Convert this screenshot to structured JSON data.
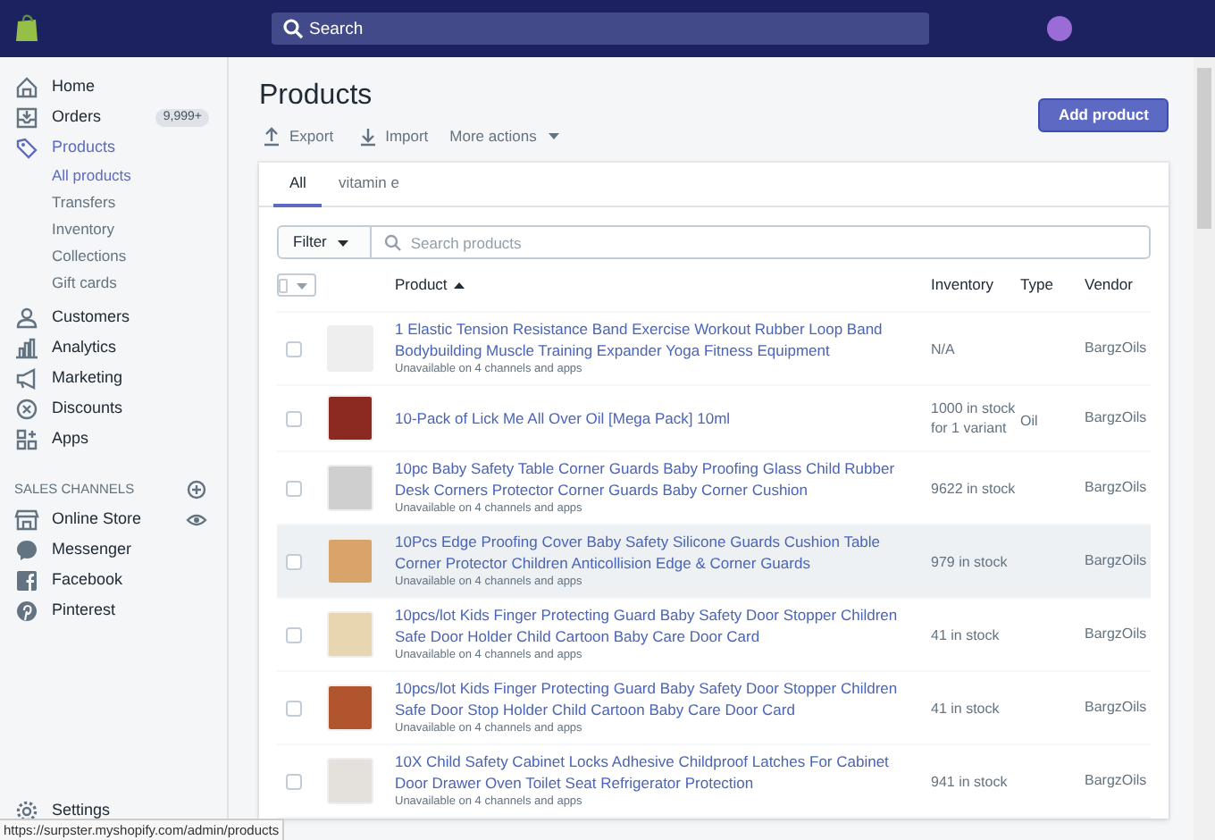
{
  "top_bar": {
    "search": {
      "placeholder": "Search"
    }
  },
  "sidebar": {
    "items": [
      {
        "label": "Home",
        "selected": false
      },
      {
        "label": "Orders",
        "badge": "9,999+",
        "selected": false
      },
      {
        "label": "Products",
        "selected": true,
        "children": [
          {
            "label": "All products",
            "selected": true
          },
          {
            "label": "Transfers",
            "selected": false
          },
          {
            "label": "Inventory",
            "selected": false
          },
          {
            "label": "Collections",
            "selected": false
          },
          {
            "label": "Gift cards",
            "selected": false
          }
        ]
      },
      {
        "label": "Customers",
        "selected": false
      },
      {
        "label": "Analytics",
        "selected": false
      },
      {
        "label": "Marketing",
        "selected": false
      },
      {
        "label": "Discounts",
        "selected": false
      },
      {
        "label": "Apps",
        "selected": false
      }
    ],
    "sales_channels": {
      "heading": "SALES CHANNELS",
      "items": [
        {
          "label": "Online Store"
        },
        {
          "label": "Messenger"
        },
        {
          "label": "Facebook"
        },
        {
          "label": "Pinterest"
        }
      ]
    },
    "settings": {
      "label": "Settings"
    }
  },
  "page": {
    "title": "Products",
    "actions": [
      "Export",
      "Import",
      "More actions"
    ],
    "primary_button": "Add product",
    "tabs": [
      {
        "label": "All",
        "selected": true
      },
      {
        "label": "vitamin e",
        "selected": false
      }
    ],
    "filter": "Filter",
    "search": {
      "placeholder": "Search products"
    },
    "select_all": {
      "checked": false
    },
    "table": {
      "columns": [
        "Product",
        "Inventory",
        "Type",
        "Vendor"
      ],
      "rows": [
        {
          "checked": false,
          "highlighted": false,
          "title": "1 Elastic Tension Resistance Band Exercise Workout Rubber Loop Band Bodybuilding Muscle Training Expander Yoga Fitness Equipment",
          "subtitle": "Unavailable on 4 channels and apps",
          "inventory": "N/A",
          "vendor": "BargzOils"
        },
        {
          "checked": false,
          "highlighted": false,
          "title": "10-Pack of Lick Me All Over Oil [Mega Pack] 10ml",
          "inventory": "1000 in stock for 1 variant",
          "type": "Oil",
          "vendor": "BargzOils"
        },
        {
          "checked": false,
          "highlighted": false,
          "title": "10pc Baby Safety Table Corner Guards Baby Proofing Glass Child Rubber Desk Corners Protector Corner Guards Baby Corner Cushion",
          "subtitle": "Unavailable on 4 channels and apps",
          "inventory": "9622 in stock",
          "vendor": "BargzOils"
        },
        {
          "checked": false,
          "highlighted": true,
          "title": "10Pcs Edge Proofing Cover Baby Safety Silicone Guards Cushion Table Corner Protector Children Anticollision Edge & Corner Guards",
          "subtitle": "Unavailable on 4 channels and apps",
          "inventory": "979 in stock",
          "vendor": "BargzOils"
        },
        {
          "checked": false,
          "highlighted": false,
          "title": "10pcs/lot Kids Finger Protecting Guard Baby Safety Door Stopper Children Safe Door Holder Child Cartoon Baby Care Door Card",
          "subtitle": "Unavailable on 4 channels and apps",
          "inventory": "41 in stock",
          "vendor": "BargzOils"
        },
        {
          "checked": false,
          "highlighted": false,
          "title": "10pcs/lot Kids Finger Protecting Guard Baby Safety Door Stopper Children Safe Door Stop Holder Child Cartoon Baby Care Door Card",
          "subtitle": "Unavailable on 4 channels and apps",
          "inventory": "41 in stock",
          "vendor": "BargzOils"
        },
        {
          "checked": false,
          "highlighted": false,
          "title": "10X Child Safety Cabinet Locks Adhesive Childproof Latches For Cabinet Door Drawer Oven Toilet Seat Refrigerator Protection",
          "subtitle": "Unavailable on 4 channels and apps",
          "inventory": "941 in stock",
          "vendor": "BargzOils"
        }
      ]
    }
  },
  "status_bar": {
    "url": "https://surpster.myshopify.com/admin/products"
  }
}
